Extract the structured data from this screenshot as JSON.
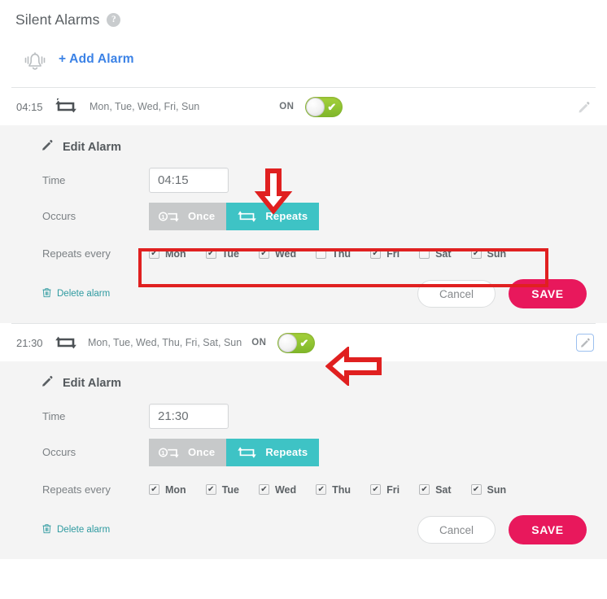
{
  "header": {
    "title": "Silent Alarms",
    "help_icon": "question-mark-icon",
    "help_glyph": "?"
  },
  "add_alarm": {
    "icon": "bell-icon",
    "label": "+ Add Alarm"
  },
  "labels": {
    "edit_alarm": "Edit Alarm",
    "time": "Time",
    "occurs": "Occurs",
    "repeats_every": "Repeats every",
    "once": "Once",
    "repeats": "Repeats",
    "delete_alarm": "Delete alarm",
    "cancel": "Cancel",
    "save": "SAVE",
    "on": "ON",
    "check_glyph": "✔"
  },
  "colors": {
    "accent_teal": "#3ec3c5",
    "save_pink": "#e8185c",
    "link_blue": "#3b82e6",
    "toggle_green": "#8fc332",
    "annotation_red": "#e02020",
    "delete_teal": "#2e9aa0",
    "once_gray": "#c7c9ca",
    "panel_bg": "#f4f4f4"
  },
  "alarms": [
    {
      "time": "04:15",
      "days_summary": "Mon, Tue, Wed, Fri, Sun",
      "state_label": "ON",
      "enabled": true,
      "edit_icon_active": false,
      "occurs_selected": "Repeats",
      "days": [
        {
          "label": "Mon",
          "checked": true
        },
        {
          "label": "Tue",
          "checked": true
        },
        {
          "label": "Wed",
          "checked": true
        },
        {
          "label": "Thu",
          "checked": false
        },
        {
          "label": "Fri",
          "checked": true
        },
        {
          "label": "Sat",
          "checked": false
        },
        {
          "label": "Sun",
          "checked": true
        }
      ]
    },
    {
      "time": "21:30",
      "days_summary": "Mon, Tue, Wed, Thu, Fri, Sat, Sun",
      "state_label": "ON",
      "enabled": true,
      "edit_icon_active": true,
      "occurs_selected": "Repeats",
      "days": [
        {
          "label": "Mon",
          "checked": true
        },
        {
          "label": "Tue",
          "checked": true
        },
        {
          "label": "Wed",
          "checked": true
        },
        {
          "label": "Thu",
          "checked": true
        },
        {
          "label": "Fri",
          "checked": true
        },
        {
          "label": "Sat",
          "checked": true
        },
        {
          "label": "Sun",
          "checked": true
        }
      ]
    }
  ],
  "annotations": [
    {
      "name": "down-arrow-annotation",
      "shape": "arrow-down"
    },
    {
      "name": "highlight-box-annotation",
      "shape": "rectangle"
    },
    {
      "name": "left-arrow-annotation",
      "shape": "arrow-left"
    }
  ]
}
